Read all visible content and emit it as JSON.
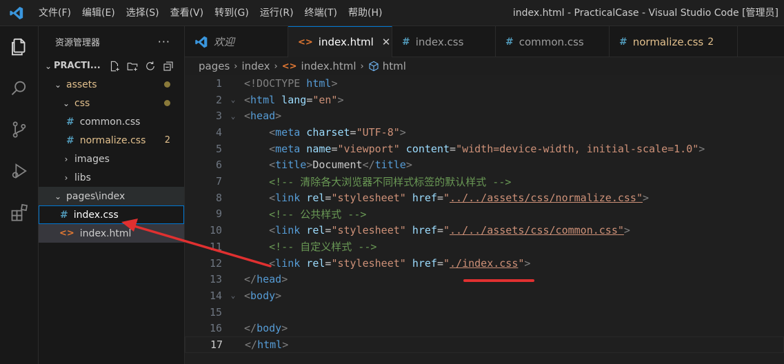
{
  "titlebar": {
    "menu": [
      "文件(F)",
      "编辑(E)",
      "选择(S)",
      "查看(V)",
      "转到(G)",
      "运行(R)",
      "终端(T)",
      "帮助(H)"
    ],
    "window_title": "index.html - PracticalCase - Visual Studio Code [管理员]"
  },
  "sidebar": {
    "header": "资源管理器",
    "more": "···",
    "project": "PRACTI...",
    "tree": {
      "assets": "assets",
      "css": "css",
      "common_css": "common.css",
      "normalize_css": "normalize.css",
      "normalize_badge": "2",
      "images": "images",
      "libs": "libs",
      "pages_index": "pages\\index",
      "index_css": "index.css",
      "index_html": "index.html"
    }
  },
  "tabs": [
    {
      "label": "欢迎"
    },
    {
      "label": "index.html",
      "close": "✕"
    },
    {
      "label": "index.css"
    },
    {
      "label": "common.css"
    },
    {
      "label": "normalize.css",
      "badge": "2"
    }
  ],
  "breadcrumb": [
    "pages",
    "index",
    "index.html",
    "html"
  ],
  "editor": {
    "line_numbers": [
      "1",
      "2",
      "3",
      "4",
      "5",
      "6",
      "7",
      "8",
      "9",
      "10",
      "11",
      "12",
      "13",
      "14",
      "15",
      "16",
      "17"
    ],
    "lines": {
      "l1_doctype": "<!DOCTYPE",
      "l1_html": " html",
      "l1_close": ">",
      "l2_open": "<",
      "l2_tag": "html",
      "l2_attr": " lang",
      "l2_eq": "=",
      "l2_val": "\"en\"",
      "l2_close": ">",
      "l3_open": "<",
      "l3_tag": "head",
      "l3_close": ">",
      "l4_tag": "meta",
      "l4_attr": " charset",
      "l4_val": "\"UTF-8\"",
      "l5_tag": "meta",
      "l5_attr1": " name",
      "l5_val1": "\"viewport\"",
      "l5_attr2": " content",
      "l5_val2": "\"width=device-width, initial-scale=1.0\"",
      "l6_tag": "title",
      "l6_text": "Document",
      "l6_endtag": "title",
      "l7_comment": "<!-- 清除各大浏览器不同样式标签的默认样式 -->",
      "l8_tag": "link",
      "l8_attr1": " rel",
      "l8_val1": "\"stylesheet\"",
      "l8_attr2": " href",
      "l8_q": "\"",
      "l8_path": "../../assets/css/normalize.css",
      "l9_comment": "<!-- 公共样式 -->",
      "l10_tag": "link",
      "l10_attr1": " rel",
      "l10_val1": "\"stylesheet\"",
      "l10_attr2": " href",
      "l10_q": "\"",
      "l10_path": "../../assets/css/common.css",
      "l11_comment": "<!-- 自定义样式 -->",
      "l12_tag": "link",
      "l12_attr1": " rel",
      "l12_val1": "\"stylesheet\"",
      "l12_attr2": " href",
      "l12_q": "\"",
      "l12_path": "./index.css",
      "l13_tag": "head",
      "l14_tag": "body",
      "l16_tag": "body",
      "l17_tag": "html"
    }
  },
  "colors": {
    "accent": "#0078d4",
    "annotation_red": "#e03030"
  }
}
